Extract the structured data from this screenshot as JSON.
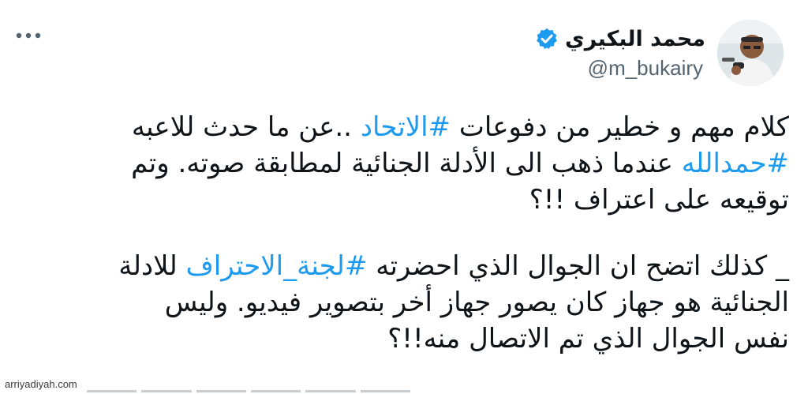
{
  "author": {
    "display_name": "محمد البكيري",
    "handle": "@m_bukairy",
    "verified": true,
    "avatar_icon": "user-avatar-icon"
  },
  "tweet": {
    "paragraphs": [
      {
        "lines": [
          [
            {
              "text": "كلام مهم و خطير من دفوعات ",
              "hashtag": false
            },
            {
              "text": "#الاتحاد",
              "hashtag": true
            },
            {
              "text": " ..عن ما حدث للاعبه",
              "hashtag": false
            }
          ],
          [
            {
              "text": "#حمدالله",
              "hashtag": true
            },
            {
              "text": " عندما ذهب الى الأدلة الجنائية لمطابقة صوته. وتم",
              "hashtag": false
            }
          ],
          [
            {
              "text": "توقيعه على اعتراف !!؟",
              "hashtag": false
            }
          ]
        ]
      },
      {
        "lines": [
          [
            {
              "text": "_ كذلك اتضح ان الجوال الذي احضرته ",
              "hashtag": false
            },
            {
              "text": "#لجنة_الاحتراف",
              "hashtag": true
            },
            {
              "text": " للادلة",
              "hashtag": false
            }
          ],
          [
            {
              "text": "الجنائية هو جهاز كان يصور جهاز أخر بتصوير فيديو. وليس",
              "hashtag": false
            }
          ],
          [
            {
              "text": "نفس الجوال الذي تم الاتصال منه!!؟",
              "hashtag": false
            }
          ]
        ]
      }
    ]
  },
  "watermark": "arriyadiyah.com",
  "colors": {
    "hashtag": "#1d9bf0",
    "verified": "#1d9bf0",
    "text": "#0f1419",
    "secondary": "#536471"
  },
  "icons": {
    "more": "more-options-icon",
    "verified": "verified-badge-icon"
  }
}
